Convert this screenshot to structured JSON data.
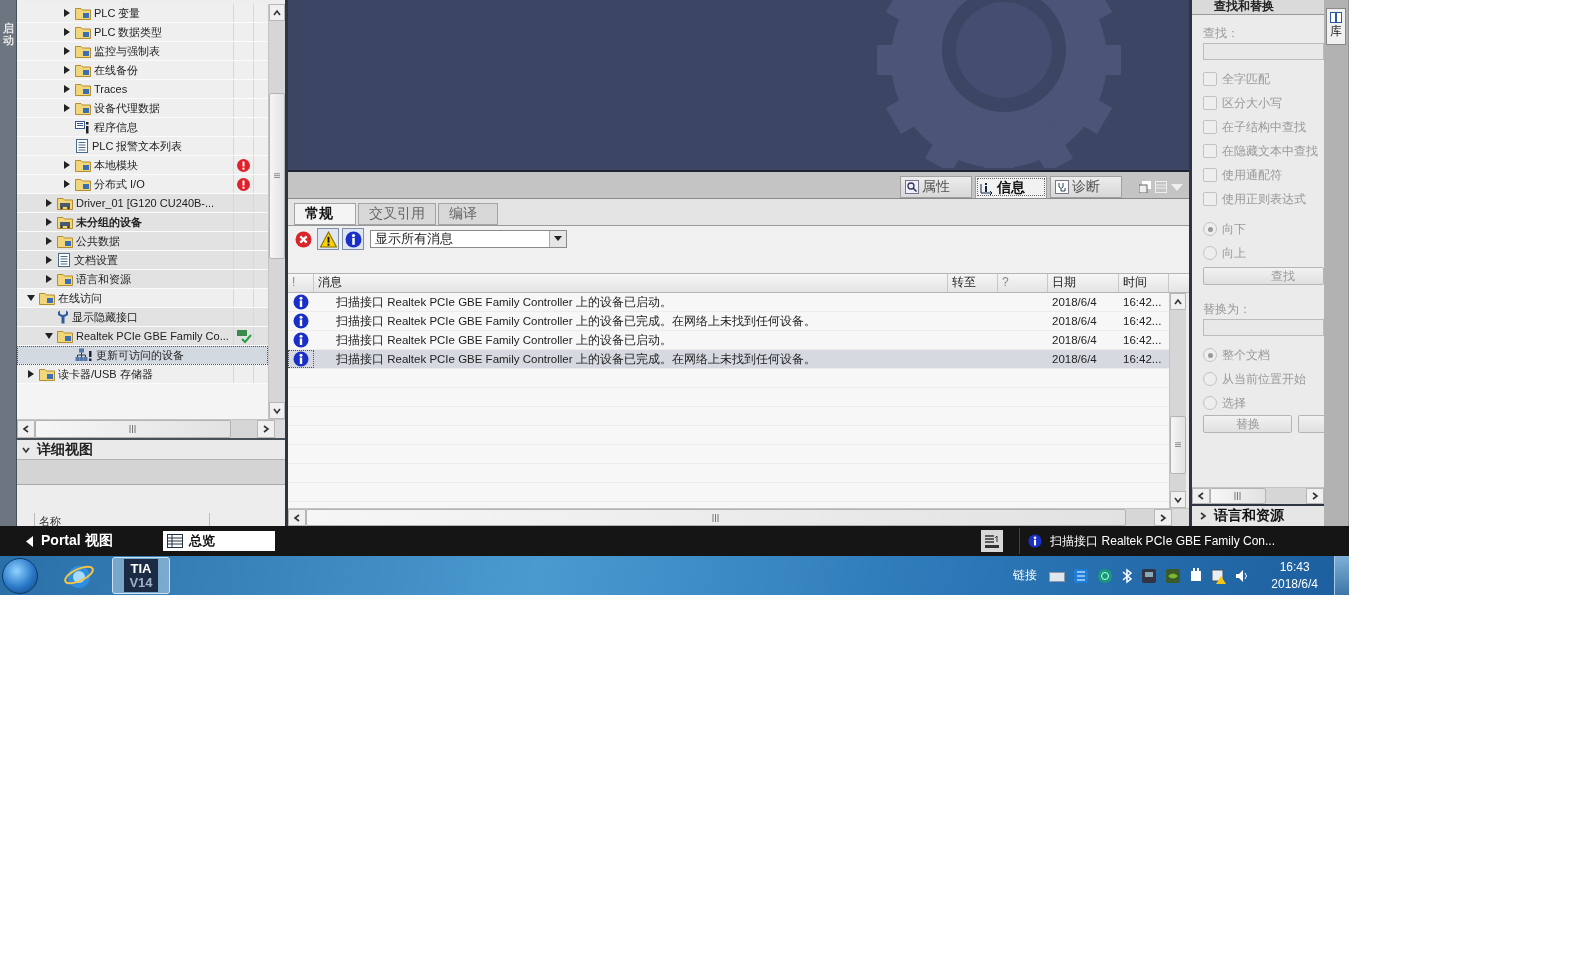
{
  "side_tab": {
    "label": "启动"
  },
  "project_tree": {
    "items": [
      {
        "children": [
          {
            "children": [
              {
                "label": "PLC 变量",
                "kind": "folder",
                "expanded": false,
                "selected": false
              },
              {
                "label": "PLC 数据类型",
                "kind": "folder",
                "expanded": false,
                "selected": false
              },
              {
                "label": "监控与强制表",
                "kind": "folder",
                "expanded": false,
                "selected": false
              },
              {
                "label": "在线备份",
                "kind": "folder",
                "expanded": false,
                "selected": false
              },
              {
                "label": "Traces",
                "kind": "folder",
                "expanded": false,
                "selected": false
              },
              {
                "label": "设备代理数据",
                "kind": "folder",
                "expanded": false,
                "selected": false
              },
              {
                "label": "程序信息",
                "kind": "info",
                "selected": false
              },
              {
                "label": "PLC 报警文本列表",
                "kind": "doc",
                "selected": false
              },
              {
                "label": "本地模块",
                "kind": "folder",
                "expanded": false,
                "error": true,
                "selected": false
              },
              {
                "label": "分布式 I/O",
                "kind": "folder",
                "expanded": false,
                "error": true,
                "selected": false
              }
            ]
          },
          {
            "label": "Driver_01 [G120 CU240B-...",
            "kind": "device",
            "expanded": false,
            "selected": false
          },
          {
            "label": "未分组的设备",
            "kind": "device",
            "expanded": false,
            "bold": true,
            "selected": false
          },
          {
            "label": "公共数据",
            "kind": "folder",
            "expanded": false,
            "selected": false
          },
          {
            "label": "文档设置",
            "kind": "doc",
            "expanded": false,
            "selected": false
          },
          {
            "label": "语言和资源",
            "kind": "folder",
            "expanded": false,
            "selected": false
          }
        ]
      },
      {
        "label": "在线访问",
        "kind": "folder",
        "expanded": true,
        "selected": false,
        "children": [
          {
            "label": "显示隐藏接口",
            "kind": "wrench",
            "selected": false
          },
          {
            "label": "Realtek PCIe GBE Family Co...",
            "kind": "folder",
            "expanded": true,
            "online": true,
            "selected": false,
            "children": [
              {
                "label": "更新可访问的设备",
                "kind": "network",
                "selected": true
              }
            ]
          }
        ]
      },
      {
        "label": "读卡器/USB 存储器",
        "kind": "folder",
        "expanded": false,
        "selected": false
      }
    ]
  },
  "detail_view": {
    "title": "详细视图",
    "columns": [
      "名称"
    ]
  },
  "inspector": {
    "tabs": [
      {
        "label": "属性",
        "kind": "properties",
        "selected": false
      },
      {
        "label": "信息",
        "kind": "info",
        "selected": true
      },
      {
        "label": "诊断",
        "kind": "diagnostics",
        "selected": false
      }
    ]
  },
  "messages": {
    "tabs": [
      {
        "label": "常规",
        "selected": true
      },
      {
        "label": "交叉引用",
        "selected": false
      },
      {
        "label": "编译",
        "selected": false
      }
    ],
    "filters": [
      {
        "kind": "error",
        "on": false
      },
      {
        "kind": "warning",
        "on": true
      },
      {
        "kind": "info",
        "on": true
      }
    ],
    "filter_value": "显示所有消息",
    "columns": [
      "!",
      "消息",
      "转至",
      "?",
      "日期",
      "时间"
    ],
    "rows": [
      {
        "kind": "info",
        "message": "扫描接口 Realtek PCIe GBE Family Controller 上的设备已启动。",
        "date": "2018/6/4",
        "time": "16:42...",
        "selected": false
      },
      {
        "kind": "info",
        "message": "扫描接口 Realtek PCIe GBE Family Controller 上的设备已完成。在网络上未找到任何设备。",
        "date": "2018/6/4",
        "time": "16:42...",
        "selected": false
      },
      {
        "kind": "info",
        "message": "扫描接口 Realtek PCIe GBE Family Controller 上的设备已启动。",
        "date": "2018/6/4",
        "time": "16:42...",
        "selected": false
      },
      {
        "kind": "info",
        "message": "扫描接口 Realtek PCIe GBE Family Controller 上的设备已完成。在网络上未找到任何设备。",
        "date": "2018/6/4",
        "time": "16:42...",
        "selected": true
      }
    ]
  },
  "find_replace": {
    "title": "查找和替换",
    "find_label": "查找：",
    "options": [
      {
        "label": "全字匹配",
        "checked": false
      },
      {
        "label": "区分大小写",
        "checked": false
      },
      {
        "label": "在子结构中查找",
        "checked": false
      },
      {
        "label": "在隐藏文本中查找",
        "checked": false
      },
      {
        "label": "使用通配符",
        "checked": false
      },
      {
        "label": "使用正则表达式",
        "checked": false
      }
    ],
    "direction": [
      {
        "label": "向下",
        "selected": true
      },
      {
        "label": "向上",
        "selected": false
      }
    ],
    "find_button": "查找",
    "replace_label": "替换为：",
    "scope": [
      {
        "label": "整个文档",
        "selected": true
      },
      {
        "label": "从当前位置开始",
        "selected": false
      },
      {
        "label": "选择",
        "selected": false
      }
    ],
    "replace_button": "替换"
  },
  "collapsed_section": {
    "title": "语言和资源",
    "expanded": false
  },
  "library_tab": {
    "label": "库"
  },
  "status_bar": {
    "portal_button": "Portal 视图",
    "overview_tab": "总览",
    "message": "扫描接口 Realtek PCIe GBE Family Con..."
  },
  "taskbar": {
    "app_button": [
      "TIA",
      "V14"
    ],
    "tray_label": "链接",
    "time": "16:43",
    "date": "2018/6/4"
  }
}
